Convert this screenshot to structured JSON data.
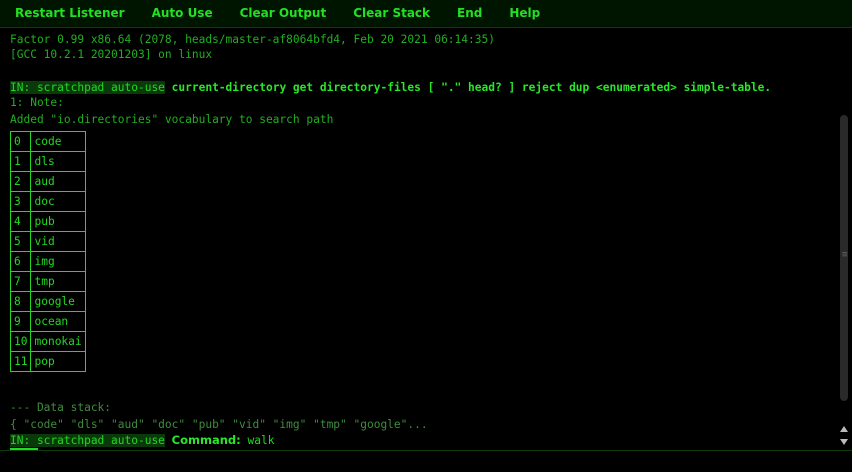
{
  "toolbar": {
    "buttons": [
      "Restart Listener",
      "Auto Use",
      "Clear Output",
      "Clear Stack",
      "End",
      "Help"
    ]
  },
  "listener": {
    "version_line": "Factor 0.99 x86.64 (2078, heads/master-af8064bfd4, Feb 20 2021 06:14:35)",
    "gcc_line": "[GCC 10.2.1 20201203] on linux",
    "in_prefix": "IN: scratchpad auto-use",
    "command": "current-directory get directory-files [ \".\" head? ] reject dup <enumerated> simple-table.",
    "note_label": "1: Note:",
    "note_text": "Added \"io.directories\" vocabulary to search path",
    "table": [
      [
        "0",
        "code"
      ],
      [
        "1",
        "dls"
      ],
      [
        "2",
        "aud"
      ],
      [
        "3",
        "doc"
      ],
      [
        "4",
        "pub"
      ],
      [
        "5",
        "vid"
      ],
      [
        "6",
        "img"
      ],
      [
        "7",
        "tmp"
      ],
      [
        "8",
        "google"
      ],
      [
        "9",
        "ocean"
      ],
      [
        "10",
        "monokai"
      ],
      [
        "11",
        "pop"
      ]
    ],
    "stack_header": "--- Data stack:",
    "stack_content": "{ \"code\" \"dls\" \"aud\" \"doc\" \"pub\" \"vid\" \"img\" \"tmp\" \"google\"...",
    "prompt_prefix": "IN: scratchpad auto-use",
    "prompt_label": "Command:",
    "prompt_input": "walk"
  },
  "colors": {
    "background": "#000000",
    "text": "#22d822",
    "toolbar_bg": "#001500",
    "prefix_bg": "#0a3a0a"
  }
}
